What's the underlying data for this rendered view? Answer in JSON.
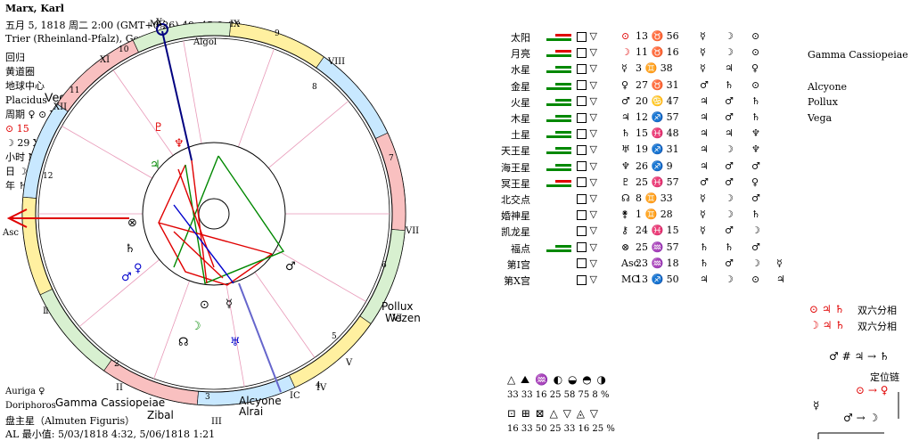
{
  "header": {
    "name": "Marx, Karl",
    "date_line": "五月 5, 1818  周二   2:00 (GMT+0:26) 49n45  6e38",
    "place": "Trier (Rheinland-Pfalz), Germany"
  },
  "left_info": {
    "lines": [
      "回归",
      "黄道圈",
      "地球中心",
      "Placidus",
      "周期 ♀ ⊙ XII",
      "⊙  15",
      "☽  29 XXVIII ♃",
      "小时 N9 ☿ □",
      "日 ☽ 2",
      "年 ♄"
    ],
    "vega_label": "Vega"
  },
  "chart_labels": {
    "asc": "Asc",
    "ic": "IC",
    "mc": "MC",
    "houses": [
      "X",
      "XI",
      "XII",
      "I",
      "II",
      "III",
      "IV",
      "V",
      "VI",
      "VII",
      "VIII",
      "IX"
    ],
    "house_numbers": [
      "10",
      "11",
      "12",
      "1",
      "2",
      "3",
      "4",
      "5",
      "6",
      "7",
      "8",
      "9"
    ],
    "stars": [
      "Pollux",
      "Wezen",
      "Alcyone",
      "Alrai",
      "Zibal",
      "Gamma Cassiopeiae",
      "Algol"
    ]
  },
  "bottom_left": {
    "auriga": "Auriga  ♀",
    "doriphoros": "Doriphoros",
    "almuten": "盘主星（Almuten Figuris）",
    "minimum": "AL 最小值: 5/03/1818  4:32,  5/06/1818  1:21"
  },
  "planets": [
    {
      "name": "太阳",
      "sym": "⊙",
      "pos": "13 ♉ 56",
      "c1": "☿",
      "c2": "☽",
      "c3": "⊙",
      "c4": "",
      "bar": "red"
    },
    {
      "name": "月亮",
      "sym": "☽",
      "pos": "11 ♉ 16",
      "c1": "☿",
      "c2": "☽",
      "c3": "⊙",
      "c4": "",
      "bar": "red"
    },
    {
      "name": "水星",
      "sym": "☿",
      "pos": "3 ♊ 38",
      "c1": "☿",
      "c2": "♃",
      "c3": "♀",
      "c4": "",
      "bar": "grn"
    },
    {
      "name": "金星",
      "sym": "♀",
      "pos": "27 ♉ 31",
      "c1": "♂",
      "c2": "♄",
      "c3": "⊙",
      "c4": "",
      "bar": "grn"
    },
    {
      "name": "火星",
      "sym": "♂",
      "pos": "20 ♋ 47",
      "c1": "♃",
      "c2": "♂",
      "c3": "♄",
      "c4": "",
      "bar": "grn"
    },
    {
      "name": "木星",
      "sym": "♃",
      "pos": "12 ♐ 57",
      "c1": "♃",
      "c2": "♂",
      "c3": "♄",
      "c4": "",
      "bar": "grn"
    },
    {
      "name": "土星",
      "sym": "♄",
      "pos": "15 ♓ 48",
      "c1": "♃",
      "c2": "♃",
      "c3": "♆",
      "c4": "",
      "bar": "grn"
    },
    {
      "name": "天王星",
      "sym": "♅",
      "pos": "19 ♐ 31",
      "c1": "♃",
      "c2": "☽",
      "c3": "♆",
      "c4": "",
      "bar": "grn"
    },
    {
      "name": "海王星",
      "sym": "♆",
      "pos": "26 ♐ 9",
      "c1": "♃",
      "c2": "♂",
      "c3": "♂",
      "c4": "",
      "bar": "grn"
    },
    {
      "name": "冥王星",
      "sym": "♇",
      "pos": "25 ♓ 57",
      "c1": "♂",
      "c2": "♂",
      "c3": "♀",
      "c4": "",
      "bar": "red"
    },
    {
      "name": "北交点",
      "sym": "☊",
      "pos": "8 ♊ 33",
      "c1": "☿",
      "c2": "☽",
      "c3": "♂",
      "c4": "",
      "bar": ""
    },
    {
      "name": "婚神星",
      "sym": "⚵",
      "pos": "1 ♊ 28",
      "c1": "☿",
      "c2": "☽",
      "c3": "♄",
      "c4": "",
      "bar": ""
    },
    {
      "name": "凯龙星",
      "sym": "⚷",
      "pos": "24 ♓ 15",
      "c1": "☿",
      "c2": "♂",
      "c3": "☽",
      "c4": "",
      "bar": ""
    },
    {
      "name": "福点",
      "sym": "⊗",
      "pos": "25 ♒ 57",
      "c1": "♄",
      "c2": "♄",
      "c3": "♂",
      "c4": "",
      "bar": "grn"
    },
    {
      "name": "第I宫",
      "sym": "Asc",
      "pos": "23 ♒ 18",
      "c1": "♄",
      "c2": "♂",
      "c3": "☽",
      "c4": "☿",
      "bar": ""
    },
    {
      "name": "第X宫",
      "sym": "MC",
      "pos": "13 ♐ 50",
      "c1": "♃",
      "c2": "☽",
      "c3": "⊙",
      "c4": "♃",
      "bar": ""
    }
  ],
  "fixed_stars": {
    "gamma": "Gamma Cassiopeiae",
    "alcyone": "Alcyone",
    "pollux": "Pollux",
    "vega": "Vega"
  },
  "aspects_right": [
    {
      "syms": "⊙  ♃  ♄",
      "label": "双六分相"
    },
    {
      "syms": "☽  ♃  ♄",
      "label": "双六分相"
    }
  ],
  "dispositor": {
    "line1": "♂ # ♃ → ♄",
    "title": "定位链",
    "line2": "⊙ → ♀",
    "left_sym": "☿",
    "line3": "♂ → ☽"
  },
  "stats": {
    "row1_syms": "△ ⛰ ♒   ◐ ◒ ◓ ◑",
    "row1_vals": "33  33  16     25  58  75   8 %",
    "row2_syms": "⊡ ⊞ ⊠     △ ▽ ◬ ▽",
    "row2_vals": "16  33  50     25  33  16  25 %"
  }
}
